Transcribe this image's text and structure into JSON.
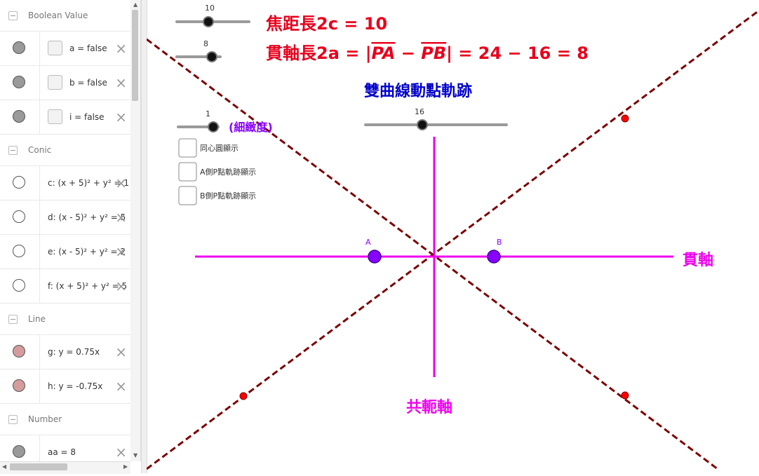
{
  "algebra": {
    "groups": [
      {
        "name": "Boolean Value",
        "items": [
          {
            "expr": "a = false",
            "marble": "#9a9a9a",
            "checkbox": true
          },
          {
            "expr": "b = false",
            "marble": "#9a9a9a",
            "checkbox": true
          },
          {
            "expr": "i = false",
            "marble": "#9a9a9a",
            "checkbox": true
          }
        ]
      },
      {
        "name": "Conic",
        "items": [
          {
            "expr": "c: (x + 5)² + y² = 1",
            "marble": "#ffffff"
          },
          {
            "expr": "d: (x - 5)² + y² = 5",
            "marble": "#ffffff"
          },
          {
            "expr": "e: (x - 5)² + y² = 2",
            "marble": "#ffffff"
          },
          {
            "expr": "f: (x + 5)² + y² = 5",
            "marble": "#ffffff"
          }
        ]
      },
      {
        "name": "Line",
        "items": [
          {
            "expr": "g: y = 0.75x",
            "marble": "#d49c9c"
          },
          {
            "expr": "h: y = -0.75x",
            "marble": "#d49c9c"
          }
        ]
      },
      {
        "name": "Number",
        "items": [
          {
            "expr": "aa = 8",
            "marble": "#9a9a9a"
          }
        ]
      }
    ]
  },
  "graphics": {
    "sliders": [
      {
        "id": "slider-c",
        "value": "10",
        "fraction": 0.45
      },
      {
        "id": "slider-a",
        "value": "8",
        "fraction": 0.8
      },
      {
        "id": "slider-fineness",
        "value": "1",
        "fraction": 0.8
      },
      {
        "id": "slider-pa",
        "value": "16",
        "fraction": 0.4
      }
    ],
    "focal_text": "焦距長2c = 10",
    "axis_text_prefix": "貫軸長2a = |",
    "axis_text_pa": "PA",
    "axis_text_minus": " − ",
    "axis_text_pb": "PB",
    "axis_text_suffix": "| = 24 − 16 = 8",
    "title": "雙曲線動點軌跡",
    "fineness_label": "(細緻度)",
    "checkboxes": [
      {
        "label": "同心圓顯示"
      },
      {
        "label": "A側P點軌跡顯示"
      },
      {
        "label": "B側P點軌跡顯示"
      }
    ],
    "point_a_label": "A",
    "point_b_label": "B",
    "transverse_axis_label": "貫軸",
    "conjugate_axis_label": "共軛軸",
    "colors": {
      "red_text": "#e8001c",
      "blue_title": "#0000cc",
      "magenta": "#ee00ee",
      "purple": "#8800ff",
      "asymptote": "#7b0000",
      "red_point": "#ff0000"
    }
  }
}
